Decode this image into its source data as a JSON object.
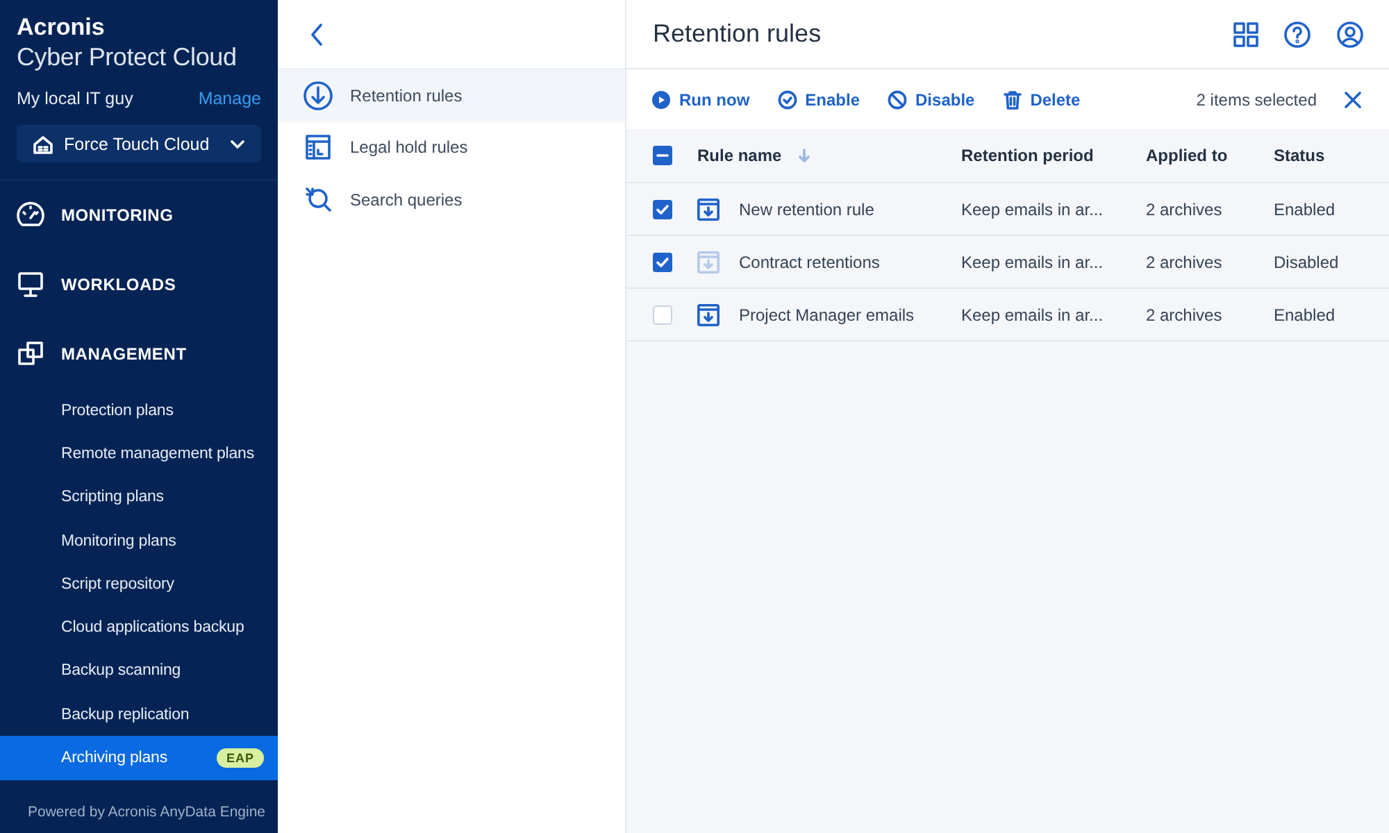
{
  "brand": {
    "logo": "Acronis",
    "product": "Cyber Protect Cloud"
  },
  "account": {
    "name": "My local IT guy",
    "manage": "Manage"
  },
  "tenant": {
    "label": "Force Touch Cloud"
  },
  "sections": [
    {
      "label": "MONITORING"
    },
    {
      "label": "WORKLOADS"
    },
    {
      "label": "MANAGEMENT",
      "children": [
        {
          "label": "Protection plans",
          "selected": false
        },
        {
          "label": "Remote management plans",
          "selected": false
        },
        {
          "label": "Scripting plans",
          "selected": false
        },
        {
          "label": "Monitoring plans",
          "selected": false
        },
        {
          "label": "Script repository",
          "selected": false
        },
        {
          "label": "Cloud applications backup",
          "selected": false
        },
        {
          "label": "Backup scanning",
          "selected": false
        },
        {
          "label": "Backup replication",
          "selected": false
        },
        {
          "label": "Archiving plans",
          "selected": true,
          "badge": "EAP"
        }
      ]
    }
  ],
  "footer": "Powered by Acronis AnyData Engine",
  "subnav": [
    {
      "label": "Retention rules",
      "selected": true
    },
    {
      "label": "Legal hold rules",
      "selected": false
    },
    {
      "label": "Search queries",
      "selected": false
    }
  ],
  "page_title": "Retention rules",
  "toolbar": {
    "actions": [
      {
        "label": "Run now"
      },
      {
        "label": "Enable"
      },
      {
        "label": "Disable"
      },
      {
        "label": "Delete"
      }
    ],
    "selection": "2 items selected"
  },
  "table": {
    "select_all_partial": true,
    "columns": [
      "Rule name",
      "Retention period",
      "Applied to",
      "Status"
    ],
    "rows": [
      {
        "selected": true,
        "enabled": true,
        "name": "New retention rule",
        "period": "Keep emails in ar...",
        "applied": "2 archives",
        "status": "Enabled"
      },
      {
        "selected": true,
        "enabled": false,
        "name": "Contract retentions",
        "period": "Keep emails in ar...",
        "applied": "2 archives",
        "status": "Disabled"
      },
      {
        "selected": false,
        "enabled": true,
        "name": "Project Manager emails",
        "period": "Keep emails in ar...",
        "applied": "2 archives",
        "status": "Enabled"
      }
    ]
  }
}
